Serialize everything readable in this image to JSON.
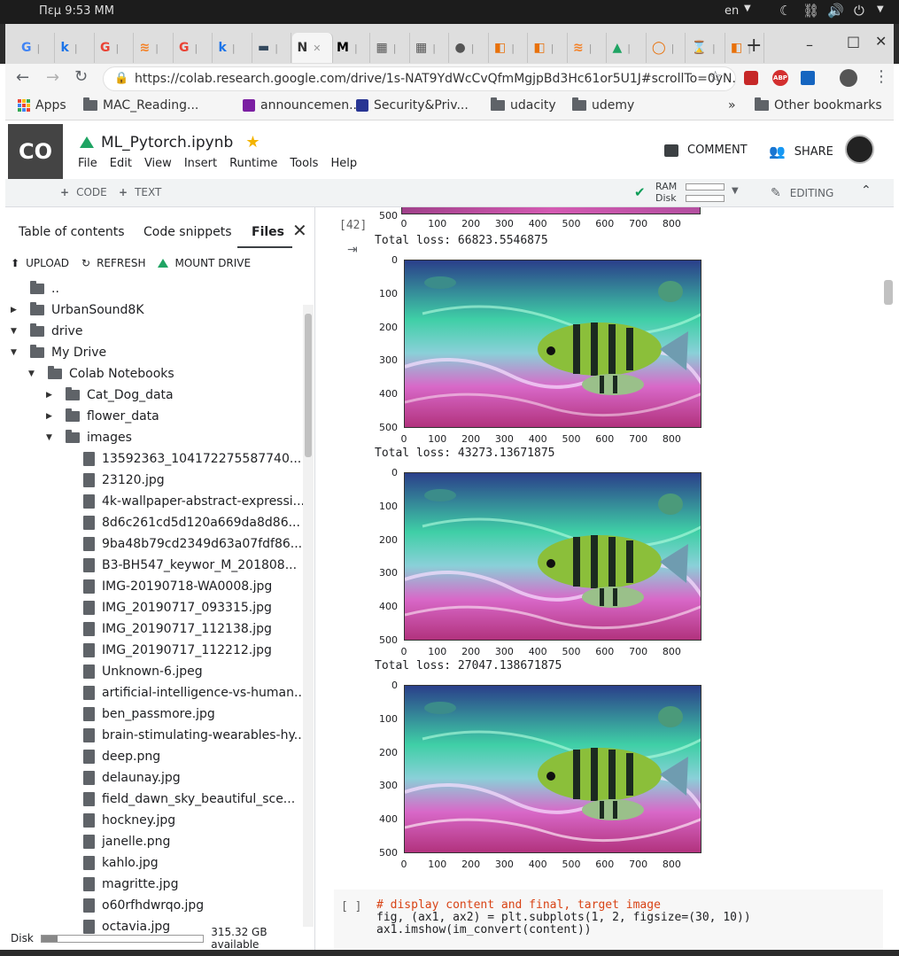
{
  "os": {
    "time": "Πεμ  9:53 ΜΜ",
    "lang": "en"
  },
  "tabs": [
    {
      "label": "G",
      "color": "#4285f4"
    },
    {
      "label": "k",
      "color": "#1a73e8"
    },
    {
      "label": "G",
      "color": "#ea4335"
    },
    {
      "label": "≋",
      "color": "#f48024"
    },
    {
      "label": "G",
      "color": "#ea4335"
    },
    {
      "label": "k",
      "color": "#1a73e8"
    },
    {
      "label": "▬",
      "color": "#34495e"
    },
    {
      "label": "N",
      "color": "#333333",
      "active": true
    },
    {
      "label": "M",
      "color": "#000000"
    },
    {
      "label": "▦",
      "color": "#555555"
    },
    {
      "label": "▦",
      "color": "#555555"
    },
    {
      "label": "●",
      "color": "#555555"
    },
    {
      "label": "◧",
      "color": "#e8710a"
    },
    {
      "label": "◧",
      "color": "#e8710a"
    },
    {
      "label": "≋",
      "color": "#f48024"
    },
    {
      "label": "▲",
      "color": "#1fa463"
    },
    {
      "label": "◯",
      "color": "#e8710a"
    },
    {
      "label": "⌛",
      "color": "#e8710a"
    },
    {
      "label": "◧",
      "color": "#e8710a"
    }
  ],
  "address": {
    "url": "https://colab.research.google.com/drive/1s-NAT9YdWcCvQfmMgjpBd3Hc61or5U1J#scrollTo=0yN..."
  },
  "bookmarks": {
    "apps": "Apps",
    "items": [
      "MAC_Reading...",
      "announcemen...",
      "Security&Priv...",
      "udacity",
      "udemy"
    ],
    "more": "»",
    "other": "Other bookmarks"
  },
  "colab": {
    "logo": "CO",
    "title": "ML_Pytorch.ipynb",
    "menu": [
      "File",
      "Edit",
      "View",
      "Insert",
      "Runtime",
      "Tools",
      "Help"
    ],
    "comment": "COMMENT",
    "share": "SHARE",
    "add_code": "CODE",
    "add_text": "TEXT",
    "ram": "RAM",
    "disk": "Disk",
    "editing": "EDITING"
  },
  "sidebar": {
    "tabs": [
      "Table of contents",
      "Code snippets",
      "Files"
    ],
    "actions": {
      "upload": "UPLOAD",
      "refresh": "REFRESH",
      "mount": "MOUNT DRIVE"
    },
    "tree": [
      {
        "name": "..",
        "type": "up",
        "level": 0
      },
      {
        "name": "UrbanSound8K",
        "type": "folder",
        "level": 0,
        "state": "collapsed"
      },
      {
        "name": "drive",
        "type": "folder",
        "level": 0,
        "state": "expanded"
      },
      {
        "name": "My Drive",
        "type": "folder",
        "level": 1,
        "state": "expanded"
      },
      {
        "name": "Colab Notebooks",
        "type": "folder",
        "level": 2,
        "state": "expanded"
      },
      {
        "name": "Cat_Dog_data",
        "type": "folder",
        "level": 3,
        "state": "collapsed"
      },
      {
        "name": "flower_data",
        "type": "folder",
        "level": 3,
        "state": "collapsed"
      },
      {
        "name": "images",
        "type": "folder",
        "level": 3,
        "state": "expanded"
      },
      {
        "name": "13592363_104172275587740...",
        "type": "file",
        "level": 4
      },
      {
        "name": "23120.jpg",
        "type": "file",
        "level": 4
      },
      {
        "name": "4k-wallpaper-abstract-expressi...",
        "type": "file",
        "level": 4
      },
      {
        "name": "8d6c261cd5d120a669da8d86...",
        "type": "file",
        "level": 4
      },
      {
        "name": "9ba48b79cd2349d63a07fdf86...",
        "type": "file",
        "level": 4
      },
      {
        "name": "B3-BH547_keywor_M_201808...",
        "type": "file",
        "level": 4
      },
      {
        "name": "IMG-20190718-WA0008.jpg",
        "type": "file",
        "level": 4
      },
      {
        "name": "IMG_20190717_093315.jpg",
        "type": "file",
        "level": 4
      },
      {
        "name": "IMG_20190717_112138.jpg",
        "type": "file",
        "level": 4
      },
      {
        "name": "IMG_20190717_112212.jpg",
        "type": "file",
        "level": 4
      },
      {
        "name": "Unknown-6.jpeg",
        "type": "file",
        "level": 4
      },
      {
        "name": "artificial-intelligence-vs-human...",
        "type": "file",
        "level": 4
      },
      {
        "name": "ben_passmore.jpg",
        "type": "file",
        "level": 4
      },
      {
        "name": "brain-stimulating-wearables-hy...",
        "type": "file",
        "level": 4
      },
      {
        "name": "deep.png",
        "type": "file",
        "level": 4
      },
      {
        "name": "delaunay.jpg",
        "type": "file",
        "level": 4
      },
      {
        "name": "field_dawn_sky_beautiful_sce...",
        "type": "file",
        "level": 4
      },
      {
        "name": "hockney.jpg",
        "type": "file",
        "level": 4
      },
      {
        "name": "janelle.png",
        "type": "file",
        "level": 4
      },
      {
        "name": "kahlo.jpg",
        "type": "file",
        "level": 4
      },
      {
        "name": "magritte.jpg",
        "type": "file",
        "level": 4
      },
      {
        "name": "o60rfhdwrqo.jpg",
        "type": "file",
        "level": 4
      },
      {
        "name": "octavia.jpg",
        "type": "file",
        "level": 4
      }
    ],
    "disk_label": "Disk",
    "disk_available": "315.32 GB available",
    "disk_used_fraction": 0.1
  },
  "notebook": {
    "exec_count": "[42]",
    "top_tick": "500",
    "outputs": [
      {
        "loss": "Total loss:  66823.5546875"
      },
      {
        "loss": "Total loss:  43273.13671875"
      },
      {
        "loss": "Total loss:  27047.138671875"
      }
    ],
    "y_ticks": [
      "0",
      "100",
      "200",
      "300",
      "400",
      "500"
    ],
    "x_ticks": [
      "0",
      "100",
      "200",
      "300",
      "400",
      "500",
      "600",
      "700",
      "800"
    ],
    "next_cell": {
      "prompt": "[ ]",
      "lines": [
        "# display content and final, target image",
        "fig, (ax1, ax2) = plt.subplots(1, 2, figsize=(30, 10))",
        "ax1.imshow(im_convert(content))"
      ]
    }
  }
}
